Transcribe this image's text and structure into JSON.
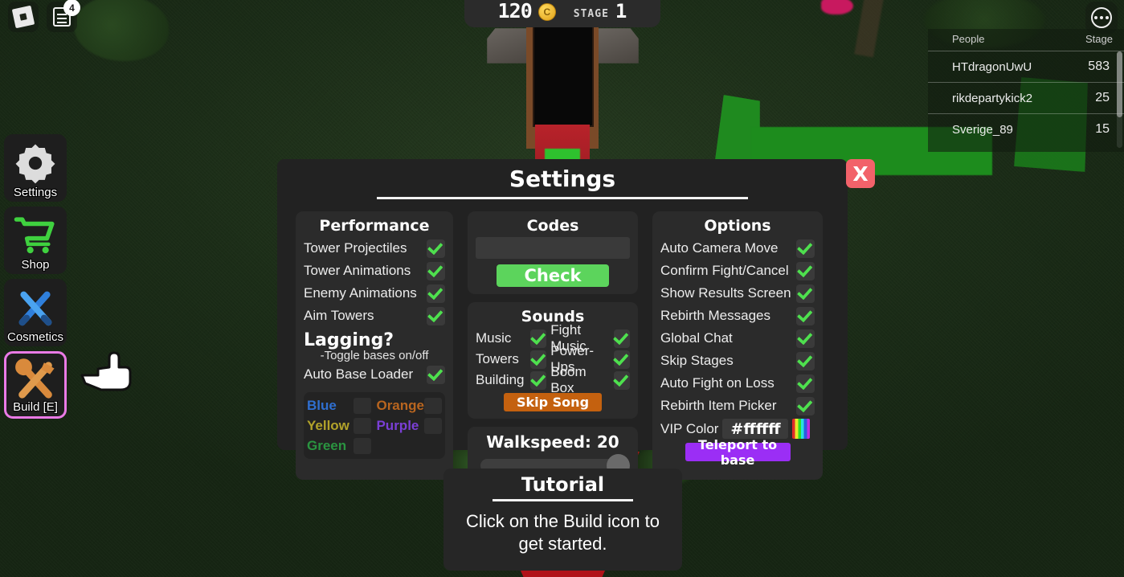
{
  "hud": {
    "coin_amount": "120",
    "coin_icon": "gold-coin",
    "stage_label": "STAGE",
    "stage_value": "1"
  },
  "roblox": {
    "logo_icon": "roblox-logo-icon",
    "chat_icon": "chat-document-icon",
    "chat_badge": "4",
    "menu_icon": "three-dots-icon"
  },
  "leaderboard": {
    "col_people": "People",
    "col_stage": "Stage",
    "rows": [
      {
        "name": "HTdragonUwU",
        "stage": "583"
      },
      {
        "name": "rikdepartykick2",
        "stage": "25"
      },
      {
        "name": "Sverige_89",
        "stage": "15"
      }
    ]
  },
  "sidebar": {
    "items": [
      {
        "label": "Settings",
        "icon": "gear-icon",
        "selected": false
      },
      {
        "label": "Shop",
        "icon": "shopping-cart-icon",
        "selected": false
      },
      {
        "label": "Cosmetics",
        "icon": "crossed-brushes-icon",
        "selected": false
      },
      {
        "label": "Build [E]",
        "icon": "hammer-wrench-icon",
        "selected": true
      }
    ],
    "cursor_icon": "pointing-hand-cursor"
  },
  "settings": {
    "title": "Settings",
    "close_label": "X",
    "performance": {
      "title": "Performance",
      "options": [
        {
          "label": "Tower Projectiles",
          "checked": true
        },
        {
          "label": "Tower Animations",
          "checked": true
        },
        {
          "label": "Enemy Animations",
          "checked": true
        },
        {
          "label": "Aim Towers",
          "checked": true
        }
      ],
      "lagging_heading": "Lagging?",
      "lagging_sub": "-Toggle bases on/off",
      "auto_base_loader": {
        "label": "Auto Base Loader",
        "checked": true
      },
      "base_colors": [
        {
          "name": "Blue",
          "color": "#2f6fd0",
          "checked": false
        },
        {
          "name": "Orange",
          "color": "#b8651f",
          "checked": false
        },
        {
          "name": "Yellow",
          "color": "#b2a32a",
          "checked": false
        },
        {
          "name": "Purple",
          "color": "#7b3fd6",
          "checked": false
        },
        {
          "name": "Green",
          "color": "#2a9440",
          "checked": false
        }
      ]
    },
    "codes": {
      "title": "Codes",
      "input_value": "",
      "input_placeholder": "",
      "check_label": "Check"
    },
    "sounds": {
      "title": "Sounds",
      "rows": [
        {
          "left_label": "Music",
          "left_checked": true,
          "right_label": "Fight Music",
          "right_checked": true
        },
        {
          "left_label": "Towers",
          "left_checked": true,
          "right_label": "Power-Ups",
          "right_checked": true
        },
        {
          "left_label": "Building",
          "left_checked": true,
          "right_label": "Boom Box",
          "right_checked": true
        }
      ],
      "skip_song_label": "Skip Song"
    },
    "walkspeed": {
      "title": "Walkspeed: 20",
      "value": 20,
      "slider_position_pct": 100
    },
    "options": {
      "title": "Options",
      "items": [
        {
          "label": "Auto Camera Move",
          "checked": true
        },
        {
          "label": "Confirm Fight/Cancel",
          "checked": true
        },
        {
          "label": "Show Results Screen",
          "checked": true
        },
        {
          "label": "Rebirth Messages",
          "checked": true
        },
        {
          "label": "Global Chat",
          "checked": true
        },
        {
          "label": "Skip Stages",
          "checked": true
        },
        {
          "label": "Auto Fight on Loss",
          "checked": true
        },
        {
          "label": "Rebirth Item Picker",
          "checked": true
        }
      ],
      "vip_color_label": "VIP Color",
      "vip_color_value": "#ffffff",
      "rainbow_swatch_icon": "rainbow-swatch-icon",
      "teleport_label": "Teleport to base"
    }
  },
  "tutorial": {
    "title": "Tutorial",
    "body": "Click on the Build icon to get started."
  },
  "colors": {
    "accent_green": "#5cd45c",
    "close_red": "#f2626a",
    "orange": "#c4610f",
    "purple": "#9b2ef5",
    "selected_pink": "#ea7ae6",
    "panel_bg": "#222222",
    "card_bg": "#2b2b2b"
  }
}
